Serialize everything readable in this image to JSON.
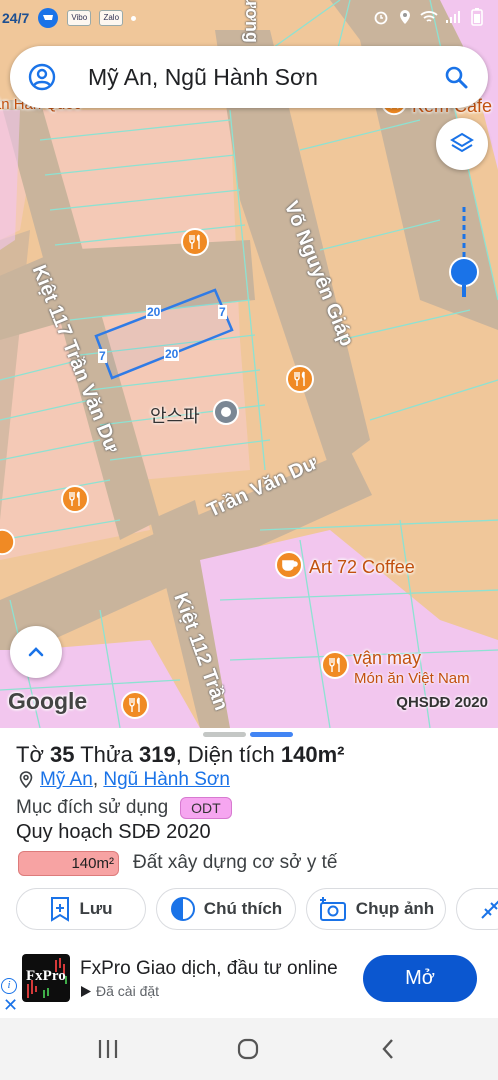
{
  "status_bar": {
    "left_text": "24/7",
    "app_icons": [
      "Vibo",
      "Zalo"
    ],
    "icons": [
      "alarm-icon",
      "location-icon",
      "wifi-icon",
      "signal-icon",
      "battery-icon"
    ]
  },
  "search": {
    "query": "Mỹ An, Ngũ Hành Sơn",
    "icons": [
      "account-icon",
      "search-icon"
    ]
  },
  "map": {
    "roads": [
      "Võ Nguyên Giáp",
      "Kiệt 117 Trần Văn Dư",
      "Trần Văn Dư",
      "Kiệt 112 Trần",
      "Hồ Xuân Hương"
    ],
    "places": {
      "top_left_partial": "ồn ăn Hàn Quốc",
      "top_right_partial": "Kem Cafe",
      "korean": "안스파",
      "art_coffee": "Art 72 Coffee",
      "van_may": "vận may",
      "van_may_sub": "Món ăn Việt Nam"
    },
    "parcel_dimensions": [
      "20",
      "7",
      "20",
      "7"
    ],
    "google_logo": "Google",
    "plan_badge": "QHSDĐ 2020",
    "colors": {
      "land": "#f0c79a",
      "residential": "#f4c9b6",
      "road": "#c9b49c",
      "pink_zone": "#f2c6ee",
      "parcel_line": "#8de2d2",
      "selection": "#2f7be6"
    }
  },
  "parcel": {
    "to_label": "Tờ",
    "to_value": "35",
    "thua_label": "Thửa",
    "thua_value": "319",
    "area_label": "Diện tích",
    "area_value": "140m²",
    "ward": "Mỹ An",
    "district": "Ngũ Hành Sơn",
    "purpose_label": "Mục đích sử dụng",
    "purpose_code": "ODT",
    "plan_title": "Quy hoạch SDĐ 2020",
    "plan_area": "140m²",
    "plan_use": "Đất xây dựng cơ sở y tế"
  },
  "actions": [
    {
      "label": "Lưu",
      "icon": "bookmark-add-icon"
    },
    {
      "label": "Chú thích",
      "icon": "legend-icon"
    },
    {
      "label": "Chụp ảnh",
      "icon": "camera-add-icon"
    },
    {
      "label": "",
      "icon": "measure-icon"
    }
  ],
  "ad": {
    "logo_text": "FxPro",
    "title": "FxPro Giao dịch, đầu tư online",
    "subtitle": "Đã cài đặt",
    "cta": "Mở"
  },
  "nav": {
    "icons": [
      "recent-apps-icon",
      "home-icon",
      "back-icon"
    ]
  }
}
